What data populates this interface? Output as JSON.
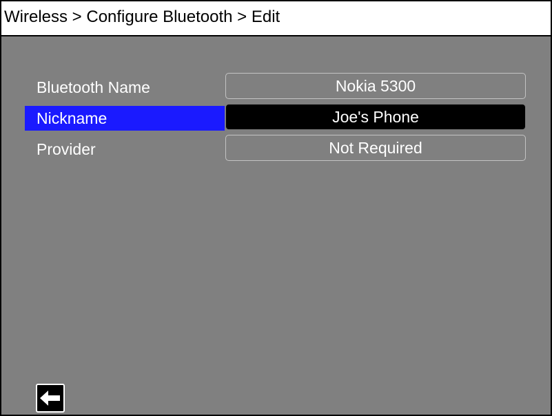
{
  "breadcrumb": "Wireless > Configure Bluetooth > Edit",
  "rows": [
    {
      "label": "Bluetooth Name",
      "value": "Nokia 5300",
      "selected": false
    },
    {
      "label": "Nickname",
      "value": "Joe's Phone",
      "selected": true
    },
    {
      "label": "Provider",
      "value": "Not Required",
      "selected": false
    }
  ],
  "back_button": {
    "icon": "left-arrow-icon"
  },
  "colors": {
    "background": "#808080",
    "selected_label": "#1a1aff",
    "selected_value": "#000000",
    "title_bar": "#ffffff"
  }
}
